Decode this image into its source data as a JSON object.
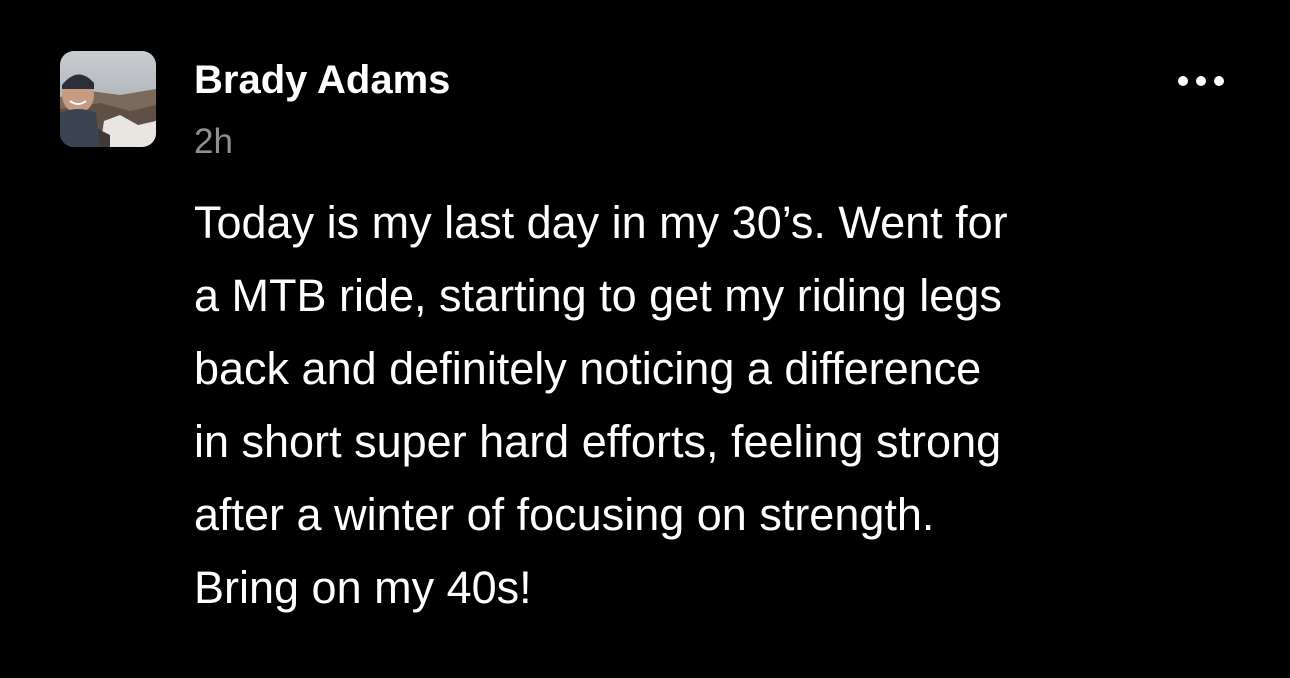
{
  "post": {
    "author": {
      "name": "Brady Adams",
      "avatar_icon": "profile-photo"
    },
    "timestamp": "2h",
    "more_icon": "ellipsis-icon",
    "body_lines": [
      "Today is my last day in my 30’s. Went for",
      "a MTB ride, starting to get my riding legs",
      "back and definitely noticing a difference",
      "in short super hard efforts, feeling strong",
      "after a winter of focusing on strength.",
      "Bring on my 40s!"
    ]
  },
  "colors": {
    "background": "#000000",
    "text": "#ffffff",
    "secondary_text": "#8e8e93"
  }
}
